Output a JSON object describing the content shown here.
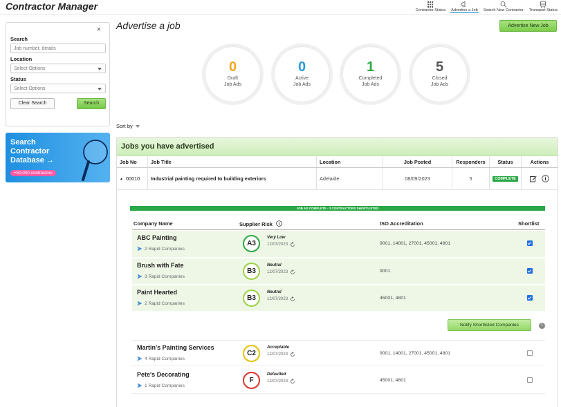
{
  "app": {
    "title": "Contractor Manager"
  },
  "topnav": [
    {
      "label": "Contractor Status",
      "icon": "grid-icon"
    },
    {
      "label": "Advertise a Job",
      "icon": "megaphone-icon",
      "active": true
    },
    {
      "label": "Search New Contractor",
      "icon": "search-people-icon"
    },
    {
      "label": "Transport Status",
      "icon": "bus-icon"
    }
  ],
  "filters": {
    "close": "×",
    "search_label": "Search",
    "search_placeholder": "Job number, details",
    "location_label": "Location",
    "location_value": "Select Options",
    "status_label": "Status",
    "status_value": "Select Options",
    "clear_label": "Clear Search",
    "search_button": "Search"
  },
  "promo": {
    "text": "Search Contractor Database →",
    "badge": "+50,000 contractors"
  },
  "main": {
    "title": "Advertise a job",
    "advertise_button": "Advertise New Job",
    "sort_label": "Sort by"
  },
  "stats": [
    {
      "value": "0",
      "label1": "Draft",
      "label2": "Job Ads",
      "color": "#f5a623"
    },
    {
      "value": "0",
      "label1": "Active",
      "label2": "Job Ads",
      "color": "#2d9ad8"
    },
    {
      "value": "1",
      "label1": "Completed",
      "label2": "Job Ads",
      "color": "#2aa845"
    },
    {
      "value": "5",
      "label1": "Closed",
      "label2": "Job Ads",
      "color": "#555555"
    }
  ],
  "jobs": {
    "header": "Jobs you have advertised",
    "columns": {
      "job_no": "Job No",
      "job_title": "Job Title",
      "location": "Location",
      "job_posted": "Job Posted",
      "responders": "Responders",
      "status": "Status",
      "actions": "Actions"
    },
    "row": {
      "expand": "▲",
      "job_no": "00010",
      "job_title": "Industrial painting required to building exteriors",
      "location": "Adelaide",
      "job_posted": "08/09/2023",
      "responders": "5",
      "status": "COMPLETE"
    }
  },
  "detail": {
    "banner": "JOB AD COMPLETE - 3 CONTRACTORS SHORTLISTED",
    "columns": {
      "company": "Company Name",
      "risk": "Supplier Risk",
      "iso": "ISO Accreditation",
      "shortlist": "Shortlist"
    },
    "notify_button": "Notify Shortlisted Companies",
    "info": "i",
    "companies": [
      {
        "name": "ABC Painting",
        "rapid": "2 Rapid Companies",
        "grade": "A3",
        "risk": "Very Low",
        "date": "12/07/2023",
        "iso": "9001, 14001, 27001, 45001, 4801",
        "shortlisted": true,
        "ring": "#2aa845"
      },
      {
        "name": "Brush with Fate",
        "rapid": "3 Rapid Companies",
        "grade": "B3",
        "risk": "Neutral",
        "date": "12/07/2023",
        "iso": "9001",
        "shortlisted": true,
        "ring": "#9bd143"
      },
      {
        "name": "Paint Hearted",
        "rapid": "2 Rapid Companies",
        "grade": "B3",
        "risk": "Neutral",
        "date": "12/07/2023",
        "iso": "45001, 4801",
        "shortlisted": true,
        "ring": "#9bd143"
      },
      {
        "name": "Martin's Painting Services",
        "rapid": "4 Rapid Companies",
        "grade": "C2",
        "risk": "Acceptable",
        "date": "12/07/2023",
        "iso": "9001, 14001, 27001, 45001, 4801",
        "shortlisted": false,
        "ring": "#e6c200"
      },
      {
        "name": "Pete's Decorating",
        "rapid": "1 Rapid Companies",
        "grade": "F",
        "risk": "Defaulted",
        "date": "12/07/2023",
        "iso": "45001, 4801",
        "shortlisted": false,
        "ring": "#d9342b"
      }
    ]
  }
}
